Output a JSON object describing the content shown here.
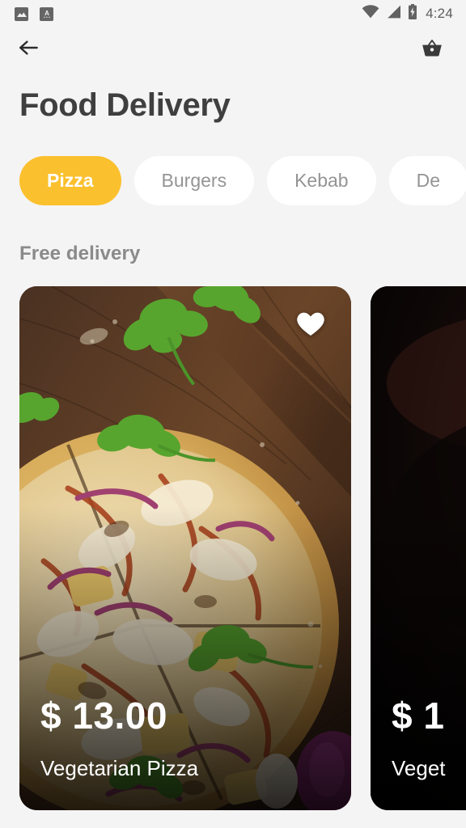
{
  "status_bar": {
    "icons_left": [
      "image-icon",
      "keyboard-a-icon"
    ],
    "icons_right": [
      "wifi-icon",
      "signal-icon",
      "battery-charging-icon"
    ],
    "time": "4:24"
  },
  "app_bar": {
    "back_icon": "back-arrow-icon",
    "cart_icon": "shopping-basket-icon"
  },
  "header": {
    "title": "Food Delivery"
  },
  "categories": {
    "items": [
      {
        "label": "Pizza",
        "active": true
      },
      {
        "label": "Burgers",
        "active": false
      },
      {
        "label": "Kebab",
        "active": false
      },
      {
        "label": "De",
        "active": false
      }
    ]
  },
  "sections": [
    {
      "title": "Free delivery",
      "cards": [
        {
          "price": "$ 13.00",
          "name": "Vegetarian Pizza",
          "favorite": true,
          "favorite_icon": "heart-filled-icon",
          "image_alt": "pizza-on-wooden-board"
        },
        {
          "price": "$ 1",
          "name": "Veget",
          "favorite": false,
          "favorite_icon": "heart-filled-icon",
          "image_alt": "dark-food-photo"
        }
      ]
    }
  ],
  "colors": {
    "accent": "#fbc02d",
    "background": "#f4f4f4",
    "chip_text": "#949494",
    "title": "#3f3f3f",
    "section_text": "#8a8a8a"
  }
}
